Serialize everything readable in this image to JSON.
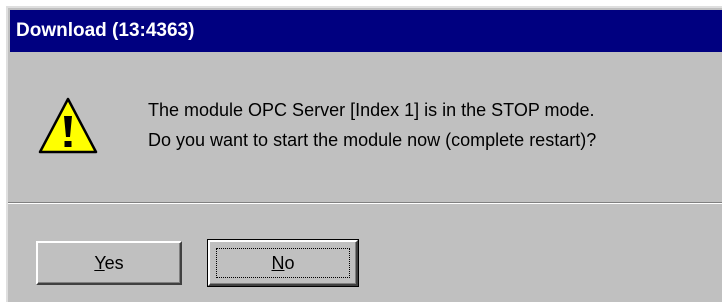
{
  "dialog": {
    "title": "Download (13:4363)",
    "icon": "warning-icon",
    "message_line1": "The module OPC Server [Index 1] is in the STOP mode.",
    "message_line2": "Do you want to start the module now (complete restart)?"
  },
  "buttons": {
    "yes": {
      "mnemonic": "Y",
      "rest": "es"
    },
    "no": {
      "mnemonic": "N",
      "rest": "o"
    }
  },
  "colors": {
    "titlebar": "#000080",
    "face": "#c0c0c0",
    "warning": "#ffff00"
  }
}
